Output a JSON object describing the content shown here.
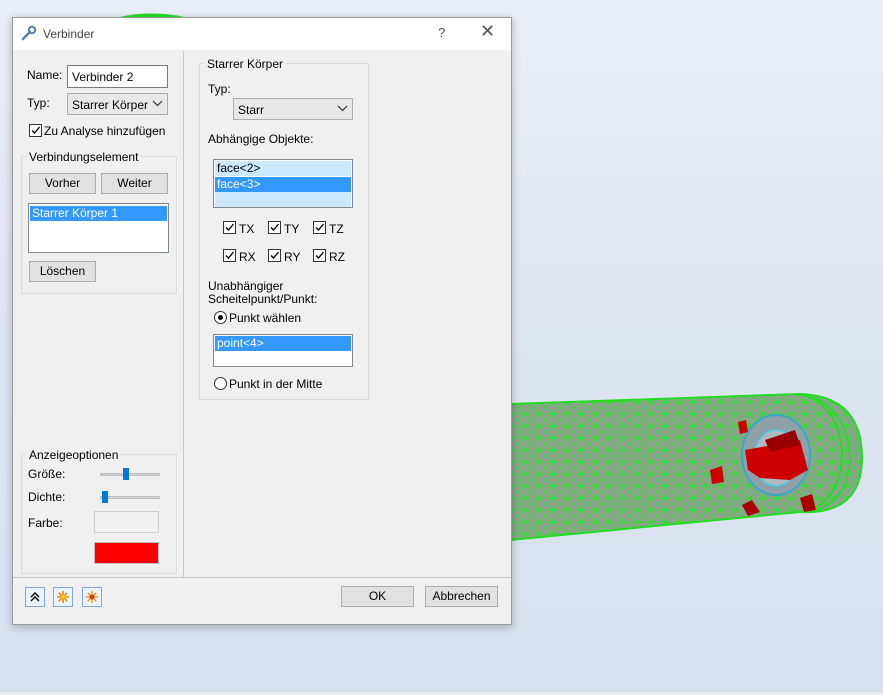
{
  "dialog": {
    "title": "Verbinder",
    "help_label": "?",
    "close_label": "✕"
  },
  "left": {
    "name_label": "Name:",
    "name_value": "Verbinder 2",
    "type_label": "Typ:",
    "type_value": "Starrer Körper",
    "add_to_analysis_label": "Zu Analyse hinzufügen",
    "add_to_analysis_checked": true,
    "connection_group_title": "Verbindungselement",
    "prev_button": "Vorher",
    "next_button": "Weiter",
    "elements": [
      "Starrer Körper 1"
    ],
    "delete_button": "Löschen",
    "display_group_title": "Anzeigeoptionen",
    "size_label": "Größe:",
    "size_level": 0.45,
    "density_label": "Dichte:",
    "density_level": 0.05,
    "color_label": "Farbe:",
    "color_value": "#ff0000"
  },
  "right": {
    "group_title": "Starrer Körper",
    "type_label": "Typ:",
    "type_value": "Starr",
    "dependent_label": "Abhängige Objekte:",
    "dependent_items": [
      "face<2>",
      "face<3>"
    ],
    "dof": [
      {
        "label": "TX",
        "checked": true
      },
      {
        "label": "TY",
        "checked": true
      },
      {
        "label": "TZ",
        "checked": true
      },
      {
        "label": "RX",
        "checked": true
      },
      {
        "label": "RY",
        "checked": true
      },
      {
        "label": "RZ",
        "checked": true
      }
    ],
    "independent_label_line1": "Unabhängiger",
    "independent_label_line2": "Scheitelpunkt/Punkt:",
    "radio_select_point": "Punkt wählen",
    "radio_select_point_checked": true,
    "point_items": [
      "point<4>"
    ],
    "radio_center_point": "Punkt in der Mitte",
    "radio_center_point_checked": false
  },
  "footer": {
    "ok_button": "OK",
    "cancel_button": "Abbrechen"
  },
  "icons": {
    "title": "connector-icon",
    "collapse": "chevron-double-up-icon",
    "highlight": "star-icon",
    "highlight_all": "multi-star-icon"
  },
  "colors": {
    "selection": "#3399ff",
    "mesh_green": "#22dd22",
    "body_red": "#cc0000"
  }
}
